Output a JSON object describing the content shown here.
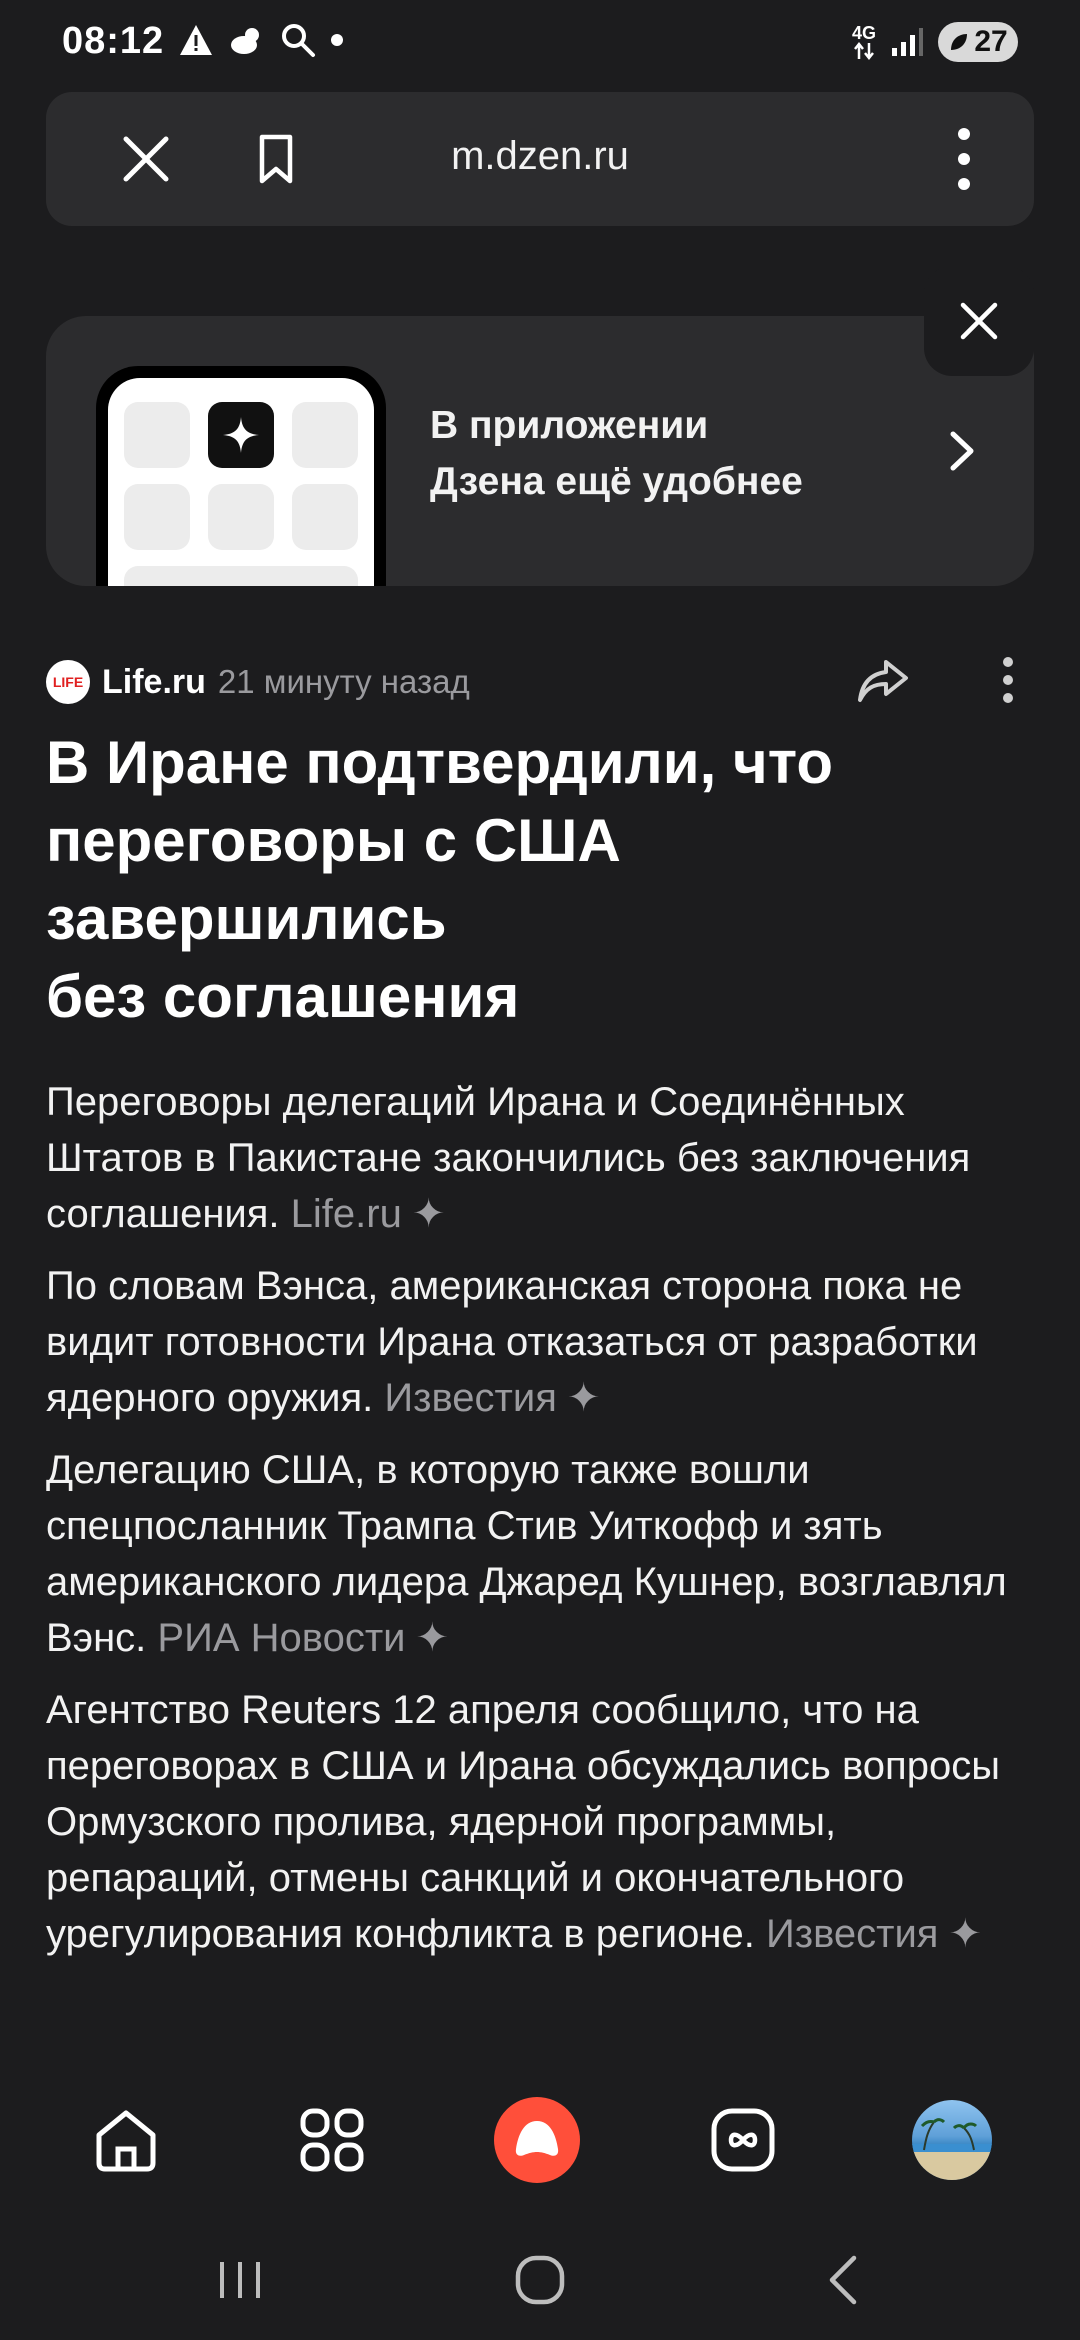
{
  "status": {
    "time": "08:12",
    "network": "4G",
    "battery": "27",
    "icons": [
      "warning-icon",
      "weather-icon",
      "search-icon",
      "dot-icon",
      "signal-icon"
    ]
  },
  "browser": {
    "url": "m.dzen.ru",
    "icons": [
      "close-icon",
      "bookmark-icon",
      "more-vertical-icon"
    ]
  },
  "promo": {
    "line1": "В приложении",
    "line2": "Дзена ещё удобнее"
  },
  "article": {
    "source": "Life.ru",
    "source_logo_text": "LIFE",
    "time_ago": "21 минуту назад",
    "headline_lines": [
      "В Иране подтвердили, что",
      "переговоры с США",
      "завершились",
      "без соглашения"
    ],
    "paragraphs": [
      {
        "text": "Переговоры делегаций Ирана и Соединённых Штатов в Пакистане закончились без заключения соглашения.",
        "source": "Life.ru"
      },
      {
        "text": "По словам Вэнса, американская сторона пока не видит готовности Ирана отказаться от разработки ядерного оружия.",
        "source": "Известия"
      },
      {
        "text": "Делегацию США, в которую также вошли спецпосланник Трампа Стив Уиткофф и зять американского лидера Джаред Кушнер, возглавлял Вэнс.",
        "source": "РИА Новости"
      },
      {
        "text": "Агентство Reuters 12 апреля сообщило, что на переговорах в США и Ирана обсуждались вопросы Ормузского пролива, ядерной программы, репараций, отмены санкций и окончательного урегулирования конфликта в регионе.",
        "source": "Известия"
      }
    ],
    "spark": "✦"
  },
  "bottom_nav": {
    "items": [
      "home-icon",
      "apps-grid-icon",
      "alice-icon",
      "video-icon",
      "avatar"
    ]
  },
  "colors": {
    "background": "#1c1c1e",
    "card": "#2c2c2e",
    "muted": "#9a9a9e",
    "alice": "#ff4f3a"
  }
}
